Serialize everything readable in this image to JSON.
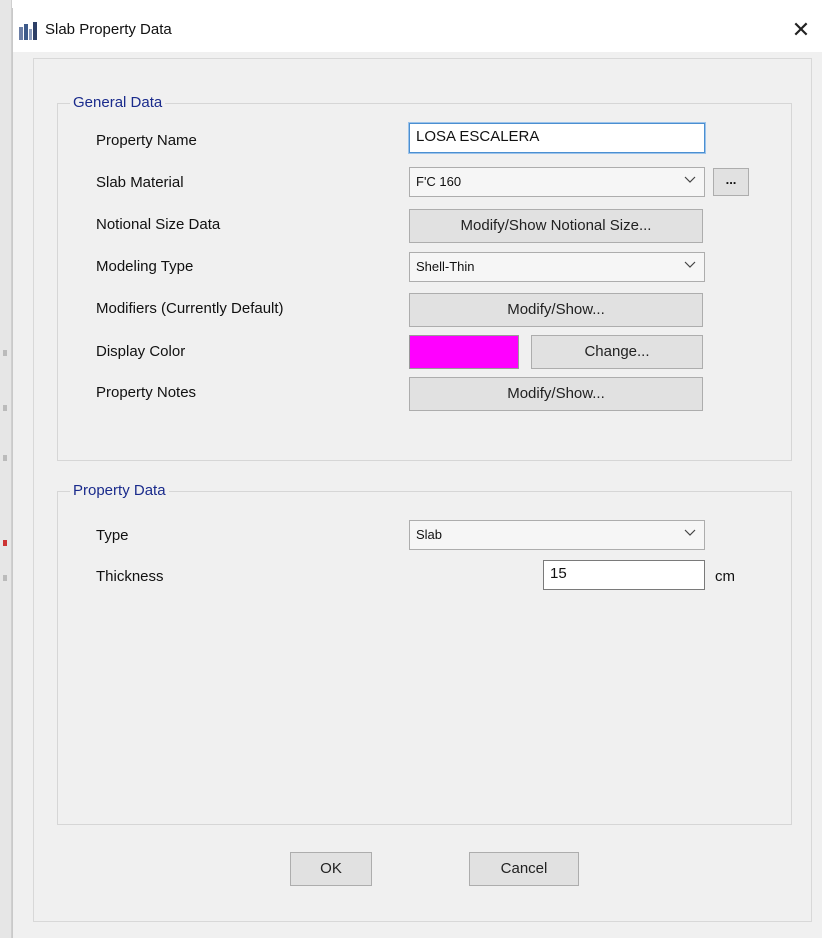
{
  "window": {
    "title": "Slab Property Data",
    "close_glyph": "✕"
  },
  "general": {
    "title": "General Data",
    "property_name_label": "Property Name",
    "property_name_value": "LOSA ESCALERA",
    "slab_material_label": "Slab Material",
    "slab_material_value": "F'C 160",
    "material_more_label": "...",
    "notional_size_label": "Notional Size Data",
    "notional_size_button": "Modify/Show Notional Size...",
    "modeling_type_label": "Modeling Type",
    "modeling_type_value": "Shell-Thin",
    "modifiers_label": "Modifiers (Currently Default)",
    "modifiers_button": "Modify/Show...",
    "display_color_label": "Display Color",
    "display_color_value": "#ff00ff",
    "change_button": "Change...",
    "property_notes_label": "Property Notes",
    "property_notes_button": "Modify/Show..."
  },
  "property_data": {
    "title": "Property Data",
    "type_label": "Type",
    "type_value": "Slab",
    "thickness_label": "Thickness",
    "thickness_value": "15",
    "thickness_unit": "cm"
  },
  "footer": {
    "ok_label": "OK",
    "cancel_label": "Cancel"
  }
}
